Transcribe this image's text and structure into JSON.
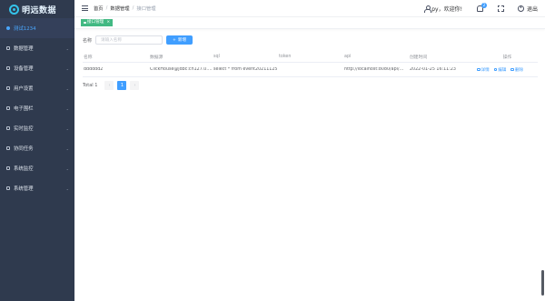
{
  "app": {
    "logo_text": "明远数据"
  },
  "sidebar": {
    "items": [
      {
        "label": "测试1234",
        "icon": "home-icon",
        "active": true
      },
      {
        "label": "数据管理",
        "icon": "grid-icon"
      },
      {
        "label": "设备管理",
        "icon": "device-icon"
      },
      {
        "label": "用户设置",
        "icon": "user-icon"
      },
      {
        "label": "电子围栏",
        "icon": "fence-icon"
      },
      {
        "label": "实时监控",
        "icon": "monitor-icon"
      },
      {
        "label": "协同任务",
        "icon": "task-icon"
      },
      {
        "label": "系统监控",
        "icon": "system-monitor-icon"
      },
      {
        "label": "系统管理",
        "icon": "settings-icon"
      }
    ]
  },
  "header": {
    "breadcrumb": [
      "首页",
      "数据管理",
      "接口管理"
    ],
    "user_greeting": "py，欢迎你!",
    "notification_count": "2",
    "logout_label": "退出"
  },
  "tags": {
    "active_tag": "接口管理"
  },
  "search": {
    "label": "名称",
    "placeholder": "请输入名称",
    "add_label": "新增"
  },
  "table": {
    "columns": [
      "名称",
      "数据源",
      "sql",
      "token",
      "api",
      "创建时间",
      "操作"
    ],
    "rows": [
      {
        "name": "dddddd2",
        "datasource": "ClickHouse@jdbc:ch127.0.0.1",
        "sql": "select * from event20211125",
        "token": "",
        "api": "http://localhost:8080/api/v1/...",
        "created_at": "2022-01-25 16:11:23",
        "actions": [
          "详情",
          "编辑",
          "删除"
        ]
      }
    ]
  },
  "pagination": {
    "total": "Total 1",
    "current_page": "1",
    "prev": "‹",
    "next": "›"
  },
  "colors": {
    "sidebar_bg": "#2f3a4e",
    "accent": "#409eff",
    "tag_green": "#42b983"
  }
}
